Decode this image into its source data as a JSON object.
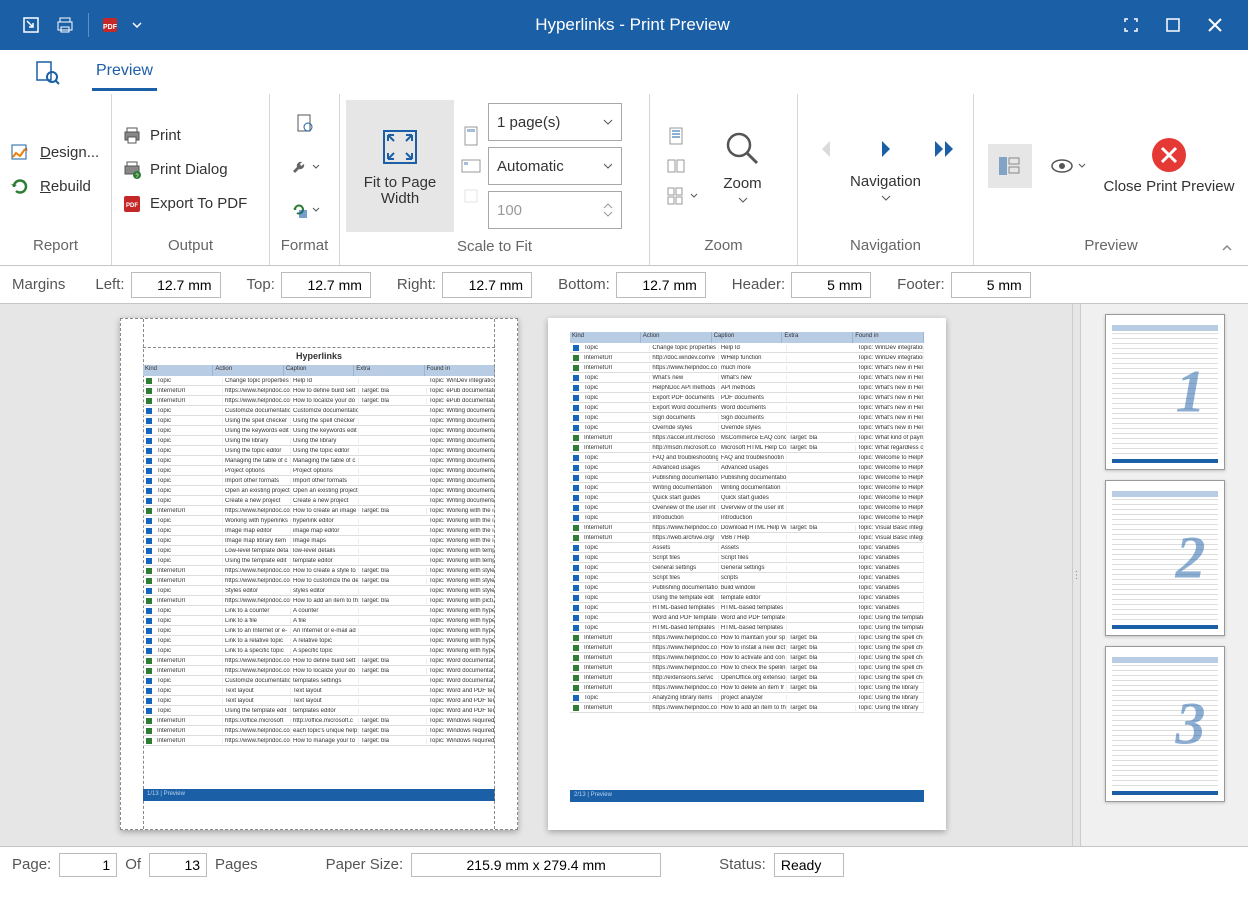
{
  "title": "Hyperlinks - Print Preview",
  "ribbonTab": "Preview",
  "groups": {
    "report": {
      "label": "Report",
      "design": "Design...",
      "rebuild": "Rebuild"
    },
    "output": {
      "label": "Output",
      "print": "Print",
      "dialog": "Print Dialog",
      "pdf": "Export To PDF"
    },
    "format": {
      "label": "Format"
    },
    "scale": {
      "label": "Scale to Fit",
      "fit": "Fit to Page Width",
      "pages": "1 page(s)",
      "auto": "Automatic",
      "zoom": "100"
    },
    "zoom": {
      "label": "Zoom",
      "btn": "Zoom"
    },
    "nav": {
      "label": "Navigation",
      "btn": "Navigation"
    },
    "preview": {
      "label": "Preview",
      "close": "Close Print Preview"
    }
  },
  "margins": {
    "label": "Margins",
    "left": {
      "l": "Left:",
      "v": "12.7 mm"
    },
    "top": {
      "l": "Top:",
      "v": "12.7 mm"
    },
    "right": {
      "l": "Right:",
      "v": "12.7 mm"
    },
    "bottom": {
      "l": "Bottom:",
      "v": "12.7 mm"
    },
    "header": {
      "l": "Header:",
      "v": "5 mm"
    },
    "footer": {
      "l": "Footer:",
      "v": "5 mm"
    }
  },
  "status": {
    "pageLabel": "Page:",
    "page": "1",
    "of": "Of",
    "total": "13",
    "pages": "Pages",
    "paperLabel": "Paper Size:",
    "paper": "215.9 mm x 279.4 mm",
    "statusLabel": "Status:",
    "status": "Ready"
  },
  "preview": {
    "title": "Hyperlinks",
    "headers": [
      "Kind",
      "Action",
      "Caption",
      "Extra",
      "Found in"
    ],
    "page1Rows": [
      [
        "g",
        "Topic",
        "Change topic properties",
        "Help Id",
        "",
        "Topic: WinDev integration"
      ],
      [
        "g",
        "InternetUrl",
        "https://www.helpndoc.co",
        "How to define build sett",
        "Target: bla",
        "Topic: ePub documentatio"
      ],
      [
        "g",
        "InternetUrl",
        "https://www.helpndoc.co",
        "How to localize your do",
        "Target: bla",
        "Topic: ePub documentatio"
      ],
      [
        "b",
        "Topic",
        "Customize documentatio",
        "Customize documentatio",
        "",
        "Topic: Writing documentat"
      ],
      [
        "b",
        "Topic",
        "Using the spell checker",
        "Using the spell checker",
        "",
        "Topic: Writing documentat"
      ],
      [
        "b",
        "Topic",
        "Using the keywords edit",
        "Using the keywords edit",
        "",
        "Topic: Writing documentat"
      ],
      [
        "b",
        "Topic",
        "Using the library",
        "Using the library",
        "",
        "Topic: Writing documentat"
      ],
      [
        "b",
        "Topic",
        "Using the topic editor",
        "Using the topic editor",
        "",
        "Topic: Writing documentat"
      ],
      [
        "b",
        "Topic",
        "Managing the table of c",
        "Managing the table of c",
        "",
        "Topic: Writing documentat"
      ],
      [
        "b",
        "Topic",
        "Project options",
        "Project options",
        "",
        "Topic: Writing documentat"
      ],
      [
        "b",
        "Topic",
        "Import other formats",
        "Import other formats",
        "",
        "Topic: Writing documentat"
      ],
      [
        "b",
        "Topic",
        "Open an existing project",
        "Open an existing project",
        "",
        "Topic: Writing documentat"
      ],
      [
        "b",
        "Topic",
        "Create a new project",
        "Create a new project",
        "",
        "Topic: Writing documentat"
      ],
      [
        "g",
        "InternetUrl",
        "https://www.helpndoc.co",
        "How to create an image",
        "Target: bla",
        "Topic: Working with the im"
      ],
      [
        "b",
        "Topic",
        "Working with hyperlinks",
        "hyperlink editor",
        "",
        "Topic: Working with the im"
      ],
      [
        "b",
        "Topic",
        "Image map editor",
        "image map editor",
        "",
        "Topic: Working with the im"
      ],
      [
        "b",
        "Topic",
        "Image map library item",
        "Image maps",
        "",
        "Topic: Working with the im"
      ],
      [
        "b",
        "Topic",
        "Low-level template deta",
        "low-level details",
        "",
        "Topic: Working with templ"
      ],
      [
        "b",
        "Topic",
        "Using the template edit",
        "template editor",
        "",
        "Topic: Working with templ"
      ],
      [
        "g",
        "InternetUrl",
        "https://www.helpndoc.co",
        "How to create a style to",
        "Target: bla",
        "Topic: Working with styles"
      ],
      [
        "g",
        "InternetUrl",
        "https://www.helpndoc.co",
        "How to customize the de",
        "Target: bla",
        "Topic: Working with styles"
      ],
      [
        "b",
        "Topic",
        "Styles editor",
        "styles editor",
        "",
        "Topic: Working with styles"
      ],
      [
        "g",
        "InternetUrl",
        "https://www.helpndoc.co",
        "How to add an item to th",
        "Target: bla",
        "Topic: Working with pictur"
      ],
      [
        "b",
        "Topic",
        "Link to a counter",
        "A counter",
        "",
        "Topic: Working with hyper"
      ],
      [
        "b",
        "Topic",
        "Link to a file",
        "A file",
        "",
        "Topic: Working with hyper"
      ],
      [
        "b",
        "Topic",
        "Link to an Internet or e-",
        "An Internet or e-mail ad",
        "",
        "Topic: Working with hyper"
      ],
      [
        "b",
        "Topic",
        "Link to a relative topic",
        "A relative topic",
        "",
        "Topic: Working with hyper"
      ],
      [
        "b",
        "Topic",
        "Link to a specific topic",
        "A specific topic",
        "",
        "Topic: Working with hyper"
      ],
      [
        "g",
        "InternetUrl",
        "https://www.helpndoc.co",
        "How to define build sett",
        "Target: bla",
        "Topic: Word documentatio"
      ],
      [
        "g",
        "InternetUrl",
        "https://www.helpndoc.co",
        "How to localize your do",
        "Target: bla",
        "Topic: Word documentatio"
      ],
      [
        "b",
        "Topic",
        "Customize documentatio",
        "templates settings",
        "",
        "Topic: Word documentatio"
      ],
      [
        "b",
        "Topic",
        "Text layout",
        "Text layout",
        "",
        "Topic: Word and PDF tem"
      ],
      [
        "b",
        "Topic",
        "Text layout",
        "Text layout",
        "",
        "Topic: Word and PDF tem"
      ],
      [
        "b",
        "Topic",
        "Using the template edit",
        "templates editor",
        "",
        "Topic: Word and PDF tem"
      ],
      [
        "g",
        "InternetUrl",
        "https://office.microsoft",
        "http://office.microsoft.c",
        "Target: bla",
        "Topic: Windows required t"
      ],
      [
        "g",
        "InternetUrl",
        "https://www.helpndoc.co",
        "each topic's unique help",
        "Target: bla",
        "Topic: Windows required t"
      ],
      [
        "g",
        "InternetUrl",
        "https://www.helpndoc.co",
        "How to manage your to",
        "Target: bla",
        "Topic: Windows required t"
      ]
    ],
    "page2Rows": [
      [
        "b",
        "Topic",
        "Change topic properties",
        "Help Id",
        "",
        "Topic: WinDev integration"
      ],
      [
        "g",
        "InternetUrl",
        "http://doc.windev.com/e",
        "WHelp function",
        "",
        "Topic: WinDev integration"
      ],
      [
        "g",
        "InternetUrl",
        "https://www.helpndoc.co",
        "much more",
        "",
        "Topic: What's new in Help"
      ],
      [
        "b",
        "Topic",
        "What's new",
        "What's new",
        "",
        "Topic: What's new in Help"
      ],
      [
        "b",
        "Topic",
        "HelpNDoc API methods",
        "API methods",
        "",
        "Topic: What's new in Help"
      ],
      [
        "b",
        "Topic",
        "Export PDF documents",
        "PDF documents",
        "",
        "Topic: What's new in Help"
      ],
      [
        "b",
        "Topic",
        "Export Word documents",
        "Word documents",
        "",
        "Topic: What's new in Help"
      ],
      [
        "b",
        "Topic",
        "Sign documents",
        "Sign documents",
        "",
        "Topic: What's new in Help"
      ],
      [
        "b",
        "Topic",
        "Override styles",
        "Override styles",
        "",
        "Topic: What's new in Help"
      ],
      [
        "g",
        "InternetUrl",
        "https://accel.int.microso",
        "MsCommerce EAQ conc",
        "Target: bla",
        "Topic: What kind of paym"
      ],
      [
        "g",
        "InternetUrl",
        "http://msdn.microsoft.co",
        "Microsoft HTML Help Co",
        "Target: bla",
        "Topic: What regardless of t"
      ],
      [
        "b",
        "Topic",
        "FAQ and troubleshooting",
        "FAQ and troubleshootin",
        "",
        "Topic: Welcome to HelpND"
      ],
      [
        "b",
        "Topic",
        "Advanced usages",
        "Advanced usages",
        "",
        "Topic: Welcome to HelpND"
      ],
      [
        "b",
        "Topic",
        "Publishing documentatio",
        "Publishing documentatio",
        "",
        "Topic: Welcome to HelpND"
      ],
      [
        "b",
        "Topic",
        "Writing documentation",
        "Writing documentation",
        "",
        "Topic: Welcome to HelpND"
      ],
      [
        "b",
        "Topic",
        "Quick start guides",
        "Quick start guides",
        "",
        "Topic: Welcome to HelpND"
      ],
      [
        "b",
        "Topic",
        "Overview of the user int",
        "Overview of the user int",
        "",
        "Topic: Welcome to HelpND"
      ],
      [
        "b",
        "Topic",
        "Introduction",
        "Introduction",
        "",
        "Topic: Welcome to HelpND"
      ],
      [
        "g",
        "InternetUrl",
        "https://www.helpndoc.co",
        "Download HTML Help W",
        "Target: bla",
        "Topic: Visual Basic integra"
      ],
      [
        "g",
        "InternetUrl",
        "https://web.archive.org/",
        "VB6 / Help",
        "",
        "Topic: Visual Basic integra"
      ],
      [
        "b",
        "Topic",
        "Assets",
        "Assets",
        "",
        "Topic: Variables"
      ],
      [
        "b",
        "Topic",
        "Script files",
        "Script files",
        "",
        "Topic: Variables"
      ],
      [
        "b",
        "Topic",
        "General settings",
        "General settings",
        "",
        "Topic: Variables"
      ],
      [
        "b",
        "Topic",
        "Script files",
        "scripts",
        "",
        "Topic: Variables"
      ],
      [
        "b",
        "Topic",
        "Publishing documentatio",
        "build window",
        "",
        "Topic: Variables"
      ],
      [
        "b",
        "Topic",
        "Using the template edit",
        "template editor",
        "",
        "Topic: Variables"
      ],
      [
        "b",
        "Topic",
        "HTML-based templates",
        "HTML-based templates",
        "",
        "Topic: Variables"
      ],
      [
        "b",
        "Topic",
        "Word and PDF template",
        "Word and PDF template",
        "",
        "Topic: Using the template"
      ],
      [
        "b",
        "Topic",
        "HTML-based templates",
        "HTML-based templates",
        "",
        "Topic: Using the template"
      ],
      [
        "g",
        "InternetUrl",
        "https://www.helpndoc.co",
        "How to maintain your sp",
        "Target: bla",
        "Topic: Using the spell che"
      ],
      [
        "g",
        "InternetUrl",
        "https://www.helpndoc.co",
        "How to install a new dict",
        "Target: bla",
        "Topic: Using the spell che"
      ],
      [
        "g",
        "InternetUrl",
        "https://www.helpndoc.co",
        "How to activate and con",
        "Target: bla",
        "Topic: Using the spell che"
      ],
      [
        "g",
        "InternetUrl",
        "https://www.helpndoc.co",
        "How to check the spellin",
        "Target: bla",
        "Topic: Using the spell che"
      ],
      [
        "g",
        "InternetUrl",
        "http://extensions.servic",
        "OpenOffice.org extensio",
        "Target: bla",
        "Topic: Using the spell che"
      ],
      [
        "g",
        "InternetUrl",
        "https://www.helpndoc.co",
        "How to delete an item fr",
        "Target: bla",
        "Topic: Using the library"
      ],
      [
        "b",
        "Topic",
        "Analyzing library items",
        "project analyzer",
        "",
        "Topic: Using the library"
      ],
      [
        "g",
        "InternetUrl",
        "https://www.helpndoc.co",
        "How to add an item to th",
        "Target: bla",
        "Topic: Using the library"
      ]
    ]
  },
  "thumbs": [
    "1",
    "2",
    "3"
  ]
}
